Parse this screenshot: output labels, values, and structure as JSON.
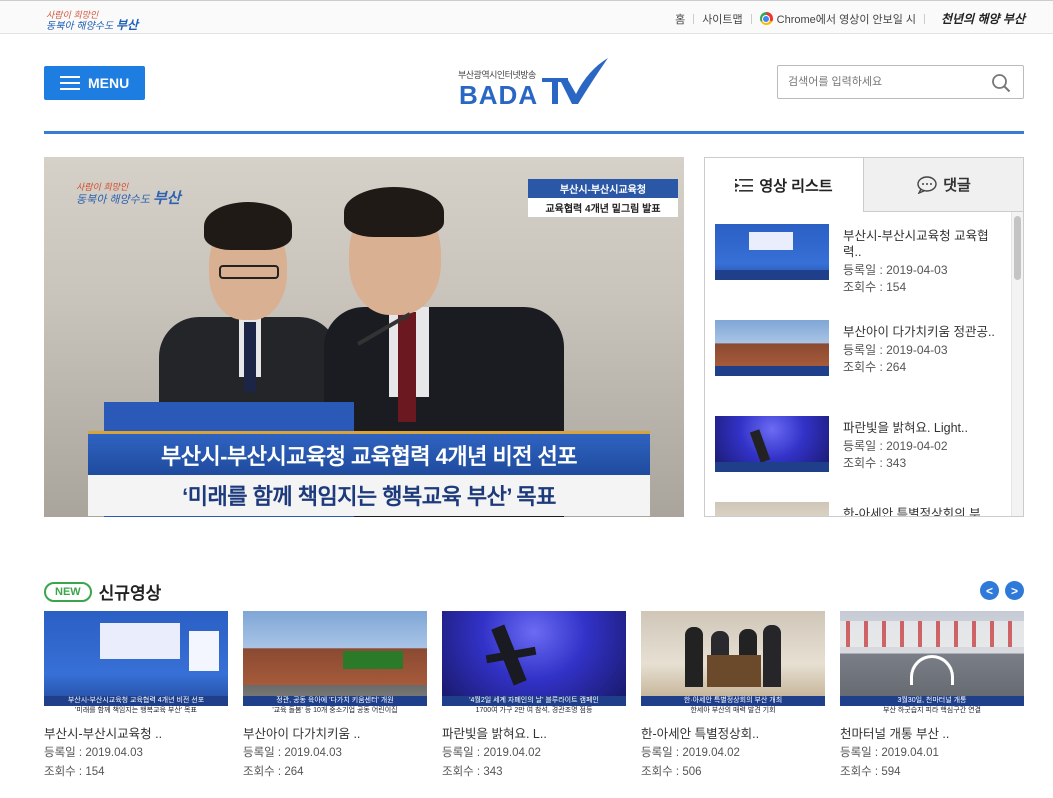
{
  "topbar": {
    "logo_line1": "사람이 희망인",
    "logo_line2": "동북아 해양수도",
    "logo_city": "부산",
    "links": [
      "홈",
      "사이트맵"
    ],
    "chrome_notice": "Chrome에서 영상이 안보일 시",
    "slogan": "천년의 해양 부산"
  },
  "header": {
    "menu_label": "MENU",
    "logo_sub": "부산광역시인터넷방송",
    "logo_main": "BADA",
    "search_placeholder": "검색어를 입력하세요"
  },
  "main_video": {
    "brand_line1": "사람이 희망인",
    "brand_line2": "동북아 해양수도",
    "brand_city": "부산",
    "top_caption_1": "부산시-부산시교육청",
    "top_caption_2": "교육협력 4개년 밑그림 발표",
    "caption_1": "부산시-부산시교육청 교육협력 4개년 비전 선포",
    "caption_2": "‘미래를 함께 책임지는 행복교육 부산’ 목표"
  },
  "side_panel": {
    "tab_list": "영상 리스트",
    "tab_comments": "댓글",
    "items": [
      {
        "title": "부산시-부산시교육청 교육협력..",
        "date": "등록일 : 2019-04-03",
        "views": "조회수 : 154",
        "thumb": "stage"
      },
      {
        "title": "부산아이 다가치키움 정관공..",
        "date": "등록일 : 2019-04-03",
        "views": "조회수 : 264",
        "thumb": "building"
      },
      {
        "title": "파란빛을 밝혀요. Light..",
        "date": "등록일 : 2019-04-02",
        "views": "조회수 : 343",
        "thumb": "night"
      },
      {
        "title": "한-아세안 특별정상회의 부..",
        "date": "",
        "views": "",
        "thumb": "room"
      }
    ]
  },
  "new_videos": {
    "badge": "NEW",
    "title": "신규영상",
    "prev_label": "<",
    "next_label": ">",
    "cards": [
      {
        "title": "부산시-부산시교육청 ..",
        "date": "등록일 : 2019.04.03",
        "views": "조회수 : 154",
        "thumb": "stage",
        "cap1": "부산시-부산시교육청 교육협력 4개년 비전 선포",
        "cap2": "'미래를 함께 책임지는 행복교육 부산' 목표"
      },
      {
        "title": "부산아이 다가치키움 ..",
        "date": "등록일 : 2019.04.03",
        "views": "조회수 : 264",
        "thumb": "building",
        "cap1": "정관, 공동 육아에 '다가치 키움센터' 개원",
        "cap2": "'교육 돌봄' 등 10개 중소기업 공동 어린이집"
      },
      {
        "title": "파란빛을 밝혀요. L..",
        "date": "등록일 : 2019.04.02",
        "views": "조회수 : 343",
        "thumb": "night",
        "cap1": "'4월2일 세계 자폐인의 날' 블루라이트 캠페인",
        "cap2": "1700여 가구 2만 여 참석, 경관조명 점등"
      },
      {
        "title": "한-아세안 특별정상회..",
        "date": "등록일 : 2019.04.02",
        "views": "조회수 : 506",
        "thumb": "room",
        "cap1": "한·아세안 특별정상회의 부산 개최",
        "cap2": "한세아 부산의 매력 발견 기회"
      },
      {
        "title": "천마터널 개통 부산 ..",
        "date": "등록일 : 2019.04.01",
        "views": "조회수 : 594",
        "thumb": "street",
        "cap1": "3월30일, 천마터널 개통",
        "cap2": "부산 하굿습지 피라 핵심구간 연결"
      }
    ]
  },
  "colors": {
    "accent_blue": "#1d7de0",
    "rule_blue": "#3a7bd5",
    "new_green": "#3aa54a"
  }
}
